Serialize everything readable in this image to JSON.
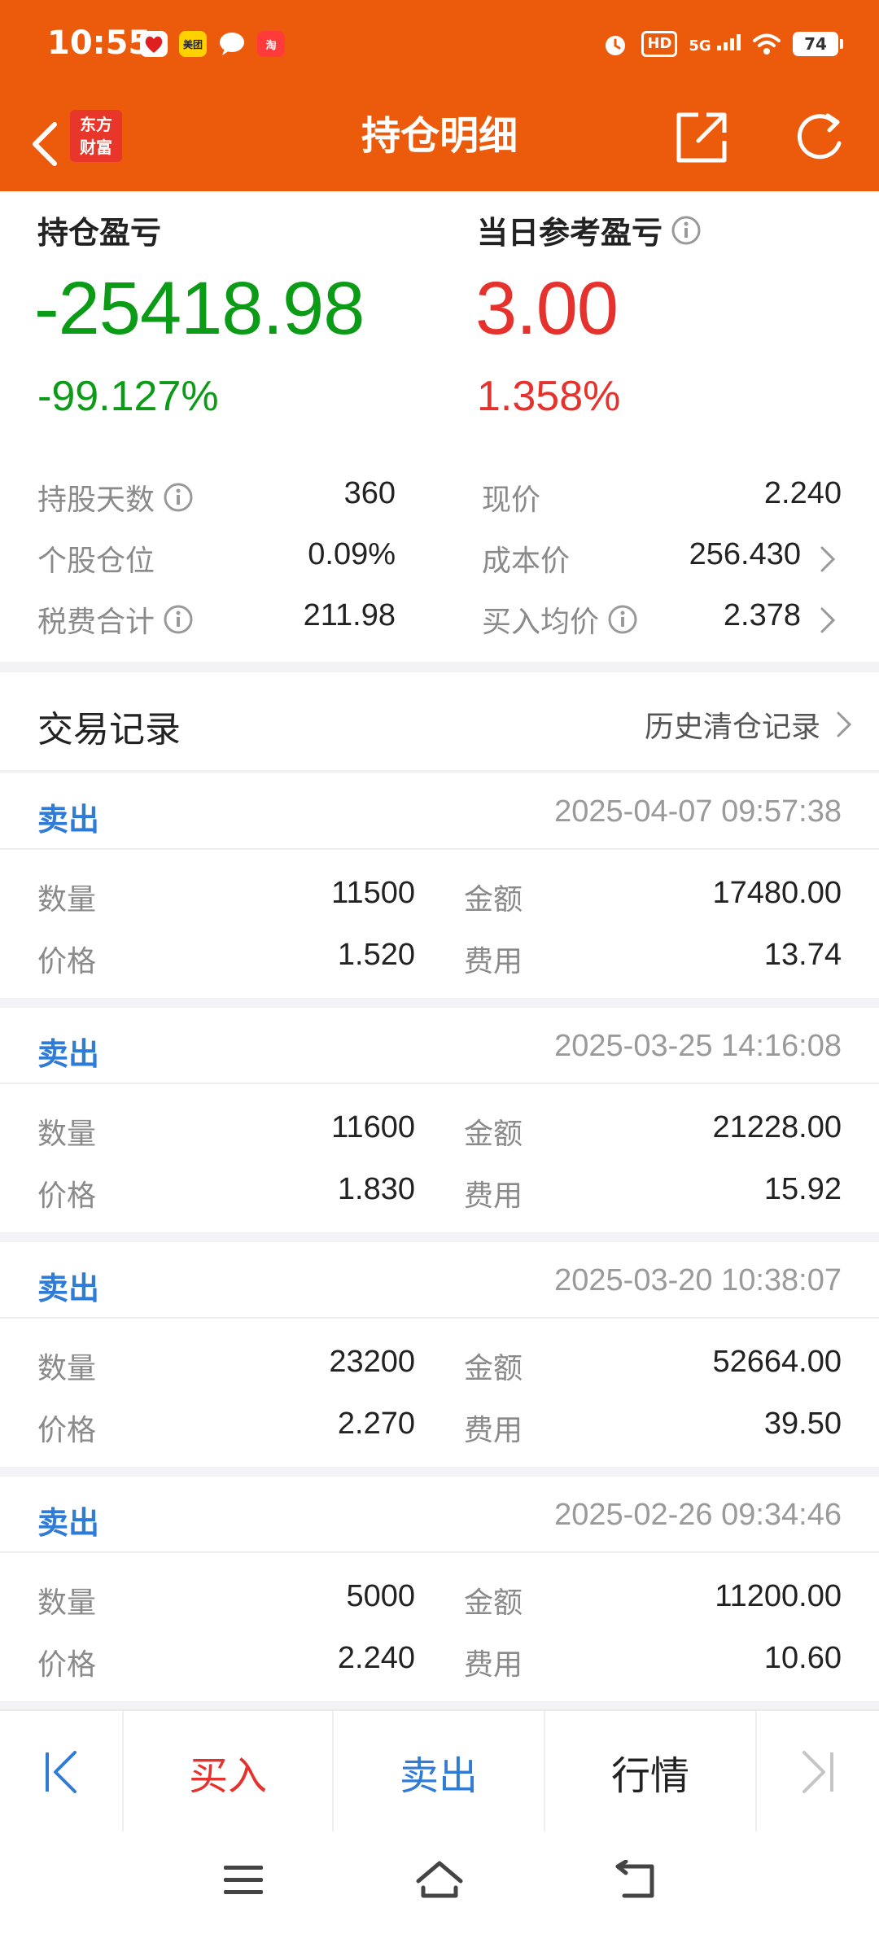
{
  "status_bar": {
    "time": "10:55",
    "app_icons": [
      "淘宝-red-app-icon",
      "美团",
      "message-bubble-icon",
      "淘"
    ],
    "meituan_label": "美团",
    "taobao_label": "淘",
    "hd_label": "HD",
    "network_label": "5G",
    "battery": "74"
  },
  "header": {
    "title": "持仓明细",
    "logo_line1": "东方",
    "logo_line2": "财富"
  },
  "summary": {
    "position_pnl_label": "持仓盈亏",
    "position_pnl_value": "-25418.98",
    "position_pnl_pct": "-99.127%",
    "daily_pnl_label": "当日参考盈亏",
    "daily_pnl_value": "3.00",
    "daily_pnl_pct": "1.358%",
    "stats": {
      "holding_days_label": "持股天数",
      "holding_days_value": "360",
      "current_price_label": "现价",
      "current_price_value": "2.240",
      "position_ratio_label": "个股仓位",
      "position_ratio_value": "0.09%",
      "cost_price_label": "成本价",
      "cost_price_value": "256.430",
      "tax_fee_label": "税费合计",
      "tax_fee_value": "211.98",
      "avg_buy_price_label": "买入均价",
      "avg_buy_price_value": "2.378"
    },
    "colors": {
      "loss": "#0c9b16",
      "gain": "#e5322d"
    }
  },
  "records": {
    "title": "交易记录",
    "history_link": "历史清仓记录",
    "labels": {
      "quantity": "数量",
      "amount": "金额",
      "price": "价格",
      "fee": "费用"
    },
    "items": [
      {
        "type": "卖出",
        "time": "2025-04-07 09:57:38",
        "quantity": "11500",
        "amount": "17480.00",
        "price": "1.520",
        "fee": "13.74"
      },
      {
        "type": "卖出",
        "time": "2025-03-25 14:16:08",
        "quantity": "11600",
        "amount": "21228.00",
        "price": "1.830",
        "fee": "15.92"
      },
      {
        "type": "卖出",
        "time": "2025-03-20 10:38:07",
        "quantity": "23200",
        "amount": "52664.00",
        "price": "2.270",
        "fee": "39.50"
      },
      {
        "type": "卖出",
        "time": "2025-02-26 09:34:46",
        "quantity": "5000",
        "amount": "11200.00",
        "price": "2.240",
        "fee": "10.60"
      }
    ]
  },
  "action_bar": {
    "buy": "买入",
    "sell": "卖出",
    "quote": "行情",
    "colors": {
      "buy": "#e5322d",
      "sell": "#2f7bd6",
      "quote": "#222222"
    }
  },
  "theme": {
    "brand": "#ec5b0b",
    "link": "#2f7bd6"
  }
}
